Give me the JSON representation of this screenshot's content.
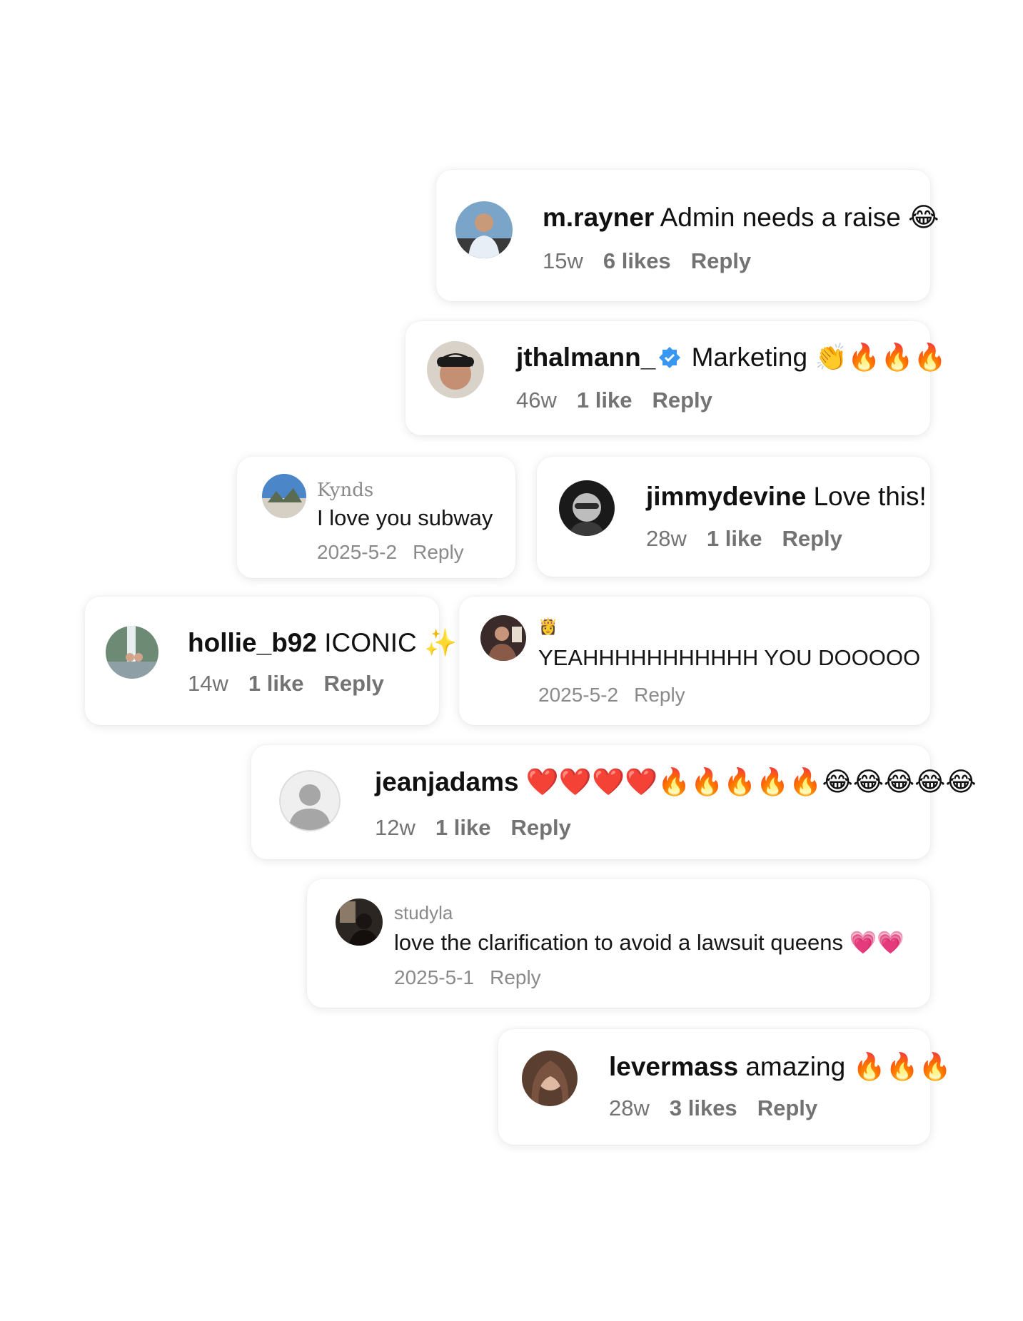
{
  "comments": [
    {
      "username": "m.rayner",
      "text": "Admin needs a raise 😂",
      "age": "15w",
      "likes": "6 likes",
      "reply": "Reply"
    },
    {
      "username": "jthalmann_",
      "text": "Marketing 👏🔥🔥🔥",
      "age": "46w",
      "likes": "1 like",
      "reply": "Reply",
      "verified_color": "#3897f0"
    },
    {
      "username": "Kynds",
      "text": "I love you subway",
      "date": "2025-5-2",
      "reply": "Reply"
    },
    {
      "username": "jimmydevine",
      "text": "Love this!",
      "age": "28w",
      "likes": "1 like",
      "reply": "Reply"
    },
    {
      "username": "hollie_b92",
      "text": "ICONIC ✨",
      "age": "14w",
      "likes": "1 like",
      "reply": "Reply"
    },
    {
      "username": "👸",
      "text": "YEAHHHHHHHHHHH YOU DOOOOO",
      "date": "2025-5-2",
      "reply": "Reply"
    },
    {
      "username": "jeanjadams",
      "text": "❤️❤️❤️❤️🔥🔥🔥🔥🔥😂😂😂😂😂",
      "age": "12w",
      "likes": "1 like",
      "reply": "Reply"
    },
    {
      "username": "studyla",
      "text": "love the clarification to avoid a lawsuit queens 💗💗",
      "date": "2025-5-1",
      "reply": "Reply"
    },
    {
      "username": "levermass",
      "text": "amazing 🔥🔥🔥",
      "age": "28w",
      "likes": "3 likes",
      "reply": "Reply"
    }
  ]
}
